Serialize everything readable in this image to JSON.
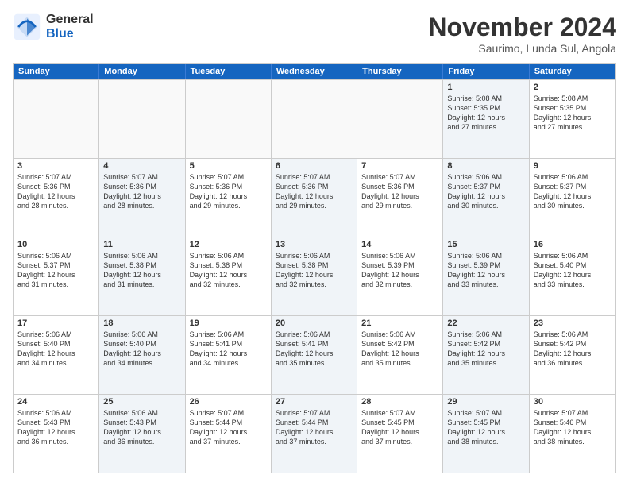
{
  "header": {
    "logo_general": "General",
    "logo_blue": "Blue",
    "month_title": "November 2024",
    "subtitle": "Saurimo, Lunda Sul, Angola"
  },
  "weekdays": [
    "Sunday",
    "Monday",
    "Tuesday",
    "Wednesday",
    "Thursday",
    "Friday",
    "Saturday"
  ],
  "weeks": [
    [
      {
        "day": "",
        "info": "",
        "empty": true
      },
      {
        "day": "",
        "info": "",
        "empty": true
      },
      {
        "day": "",
        "info": "",
        "empty": true
      },
      {
        "day": "",
        "info": "",
        "empty": true
      },
      {
        "day": "",
        "info": "",
        "empty": true
      },
      {
        "day": "1",
        "info": "Sunrise: 5:08 AM\nSunset: 5:35 PM\nDaylight: 12 hours\nand 27 minutes.",
        "empty": false
      },
      {
        "day": "2",
        "info": "Sunrise: 5:08 AM\nSunset: 5:35 PM\nDaylight: 12 hours\nand 27 minutes.",
        "empty": false
      }
    ],
    [
      {
        "day": "3",
        "info": "Sunrise: 5:07 AM\nSunset: 5:36 PM\nDaylight: 12 hours\nand 28 minutes.",
        "empty": false
      },
      {
        "day": "4",
        "info": "Sunrise: 5:07 AM\nSunset: 5:36 PM\nDaylight: 12 hours\nand 28 minutes.",
        "empty": false
      },
      {
        "day": "5",
        "info": "Sunrise: 5:07 AM\nSunset: 5:36 PM\nDaylight: 12 hours\nand 29 minutes.",
        "empty": false
      },
      {
        "day": "6",
        "info": "Sunrise: 5:07 AM\nSunset: 5:36 PM\nDaylight: 12 hours\nand 29 minutes.",
        "empty": false
      },
      {
        "day": "7",
        "info": "Sunrise: 5:07 AM\nSunset: 5:36 PM\nDaylight: 12 hours\nand 29 minutes.",
        "empty": false
      },
      {
        "day": "8",
        "info": "Sunrise: 5:06 AM\nSunset: 5:37 PM\nDaylight: 12 hours\nand 30 minutes.",
        "empty": false
      },
      {
        "day": "9",
        "info": "Sunrise: 5:06 AM\nSunset: 5:37 PM\nDaylight: 12 hours\nand 30 minutes.",
        "empty": false
      }
    ],
    [
      {
        "day": "10",
        "info": "Sunrise: 5:06 AM\nSunset: 5:37 PM\nDaylight: 12 hours\nand 31 minutes.",
        "empty": false
      },
      {
        "day": "11",
        "info": "Sunrise: 5:06 AM\nSunset: 5:38 PM\nDaylight: 12 hours\nand 31 minutes.",
        "empty": false
      },
      {
        "day": "12",
        "info": "Sunrise: 5:06 AM\nSunset: 5:38 PM\nDaylight: 12 hours\nand 32 minutes.",
        "empty": false
      },
      {
        "day": "13",
        "info": "Sunrise: 5:06 AM\nSunset: 5:38 PM\nDaylight: 12 hours\nand 32 minutes.",
        "empty": false
      },
      {
        "day": "14",
        "info": "Sunrise: 5:06 AM\nSunset: 5:39 PM\nDaylight: 12 hours\nand 32 minutes.",
        "empty": false
      },
      {
        "day": "15",
        "info": "Sunrise: 5:06 AM\nSunset: 5:39 PM\nDaylight: 12 hours\nand 33 minutes.",
        "empty": false
      },
      {
        "day": "16",
        "info": "Sunrise: 5:06 AM\nSunset: 5:40 PM\nDaylight: 12 hours\nand 33 minutes.",
        "empty": false
      }
    ],
    [
      {
        "day": "17",
        "info": "Sunrise: 5:06 AM\nSunset: 5:40 PM\nDaylight: 12 hours\nand 34 minutes.",
        "empty": false
      },
      {
        "day": "18",
        "info": "Sunrise: 5:06 AM\nSunset: 5:40 PM\nDaylight: 12 hours\nand 34 minutes.",
        "empty": false
      },
      {
        "day": "19",
        "info": "Sunrise: 5:06 AM\nSunset: 5:41 PM\nDaylight: 12 hours\nand 34 minutes.",
        "empty": false
      },
      {
        "day": "20",
        "info": "Sunrise: 5:06 AM\nSunset: 5:41 PM\nDaylight: 12 hours\nand 35 minutes.",
        "empty": false
      },
      {
        "day": "21",
        "info": "Sunrise: 5:06 AM\nSunset: 5:42 PM\nDaylight: 12 hours\nand 35 minutes.",
        "empty": false
      },
      {
        "day": "22",
        "info": "Sunrise: 5:06 AM\nSunset: 5:42 PM\nDaylight: 12 hours\nand 35 minutes.",
        "empty": false
      },
      {
        "day": "23",
        "info": "Sunrise: 5:06 AM\nSunset: 5:42 PM\nDaylight: 12 hours\nand 36 minutes.",
        "empty": false
      }
    ],
    [
      {
        "day": "24",
        "info": "Sunrise: 5:06 AM\nSunset: 5:43 PM\nDaylight: 12 hours\nand 36 minutes.",
        "empty": false
      },
      {
        "day": "25",
        "info": "Sunrise: 5:06 AM\nSunset: 5:43 PM\nDaylight: 12 hours\nand 36 minutes.",
        "empty": false
      },
      {
        "day": "26",
        "info": "Sunrise: 5:07 AM\nSunset: 5:44 PM\nDaylight: 12 hours\nand 37 minutes.",
        "empty": false
      },
      {
        "day": "27",
        "info": "Sunrise: 5:07 AM\nSunset: 5:44 PM\nDaylight: 12 hours\nand 37 minutes.",
        "empty": false
      },
      {
        "day": "28",
        "info": "Sunrise: 5:07 AM\nSunset: 5:45 PM\nDaylight: 12 hours\nand 37 minutes.",
        "empty": false
      },
      {
        "day": "29",
        "info": "Sunrise: 5:07 AM\nSunset: 5:45 PM\nDaylight: 12 hours\nand 38 minutes.",
        "empty": false
      },
      {
        "day": "30",
        "info": "Sunrise: 5:07 AM\nSunset: 5:46 PM\nDaylight: 12 hours\nand 38 minutes.",
        "empty": false
      }
    ]
  ]
}
